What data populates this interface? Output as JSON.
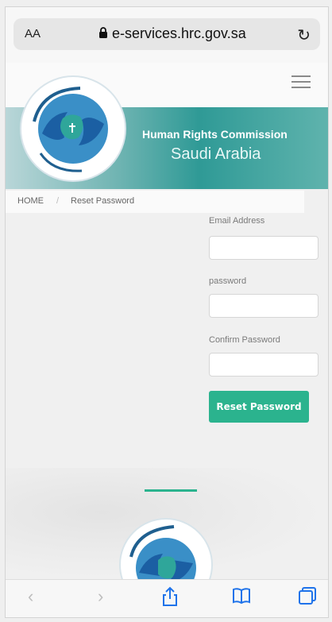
{
  "browser": {
    "text_size_label": "AA",
    "url": "e-services.hrc.gov.sa",
    "reload_icon": "reload-icon",
    "toolbar": {
      "back_icon": "back-icon",
      "forward_icon": "forward-icon",
      "share_icon": "share-icon",
      "bookmarks_icon": "bookmarks-icon",
      "tabs_icon": "tabs-icon"
    }
  },
  "site": {
    "banner": {
      "title": "Human Rights Commission",
      "subtitle": "Saudi Arabia"
    },
    "breadcrumb": {
      "home": "HOME",
      "separator": "/",
      "current": "Reset Password"
    },
    "form": {
      "email_label": "Email Address",
      "password_label": "password",
      "confirm_label": "Confirm Password",
      "email_value": "",
      "password_value": "",
      "confirm_value": "",
      "submit_label": "Reset Password"
    }
  },
  "colors": {
    "accent_green": "#2bb38e",
    "banner_teal": "#2f9a96",
    "link_blue": "#1f73ea"
  }
}
